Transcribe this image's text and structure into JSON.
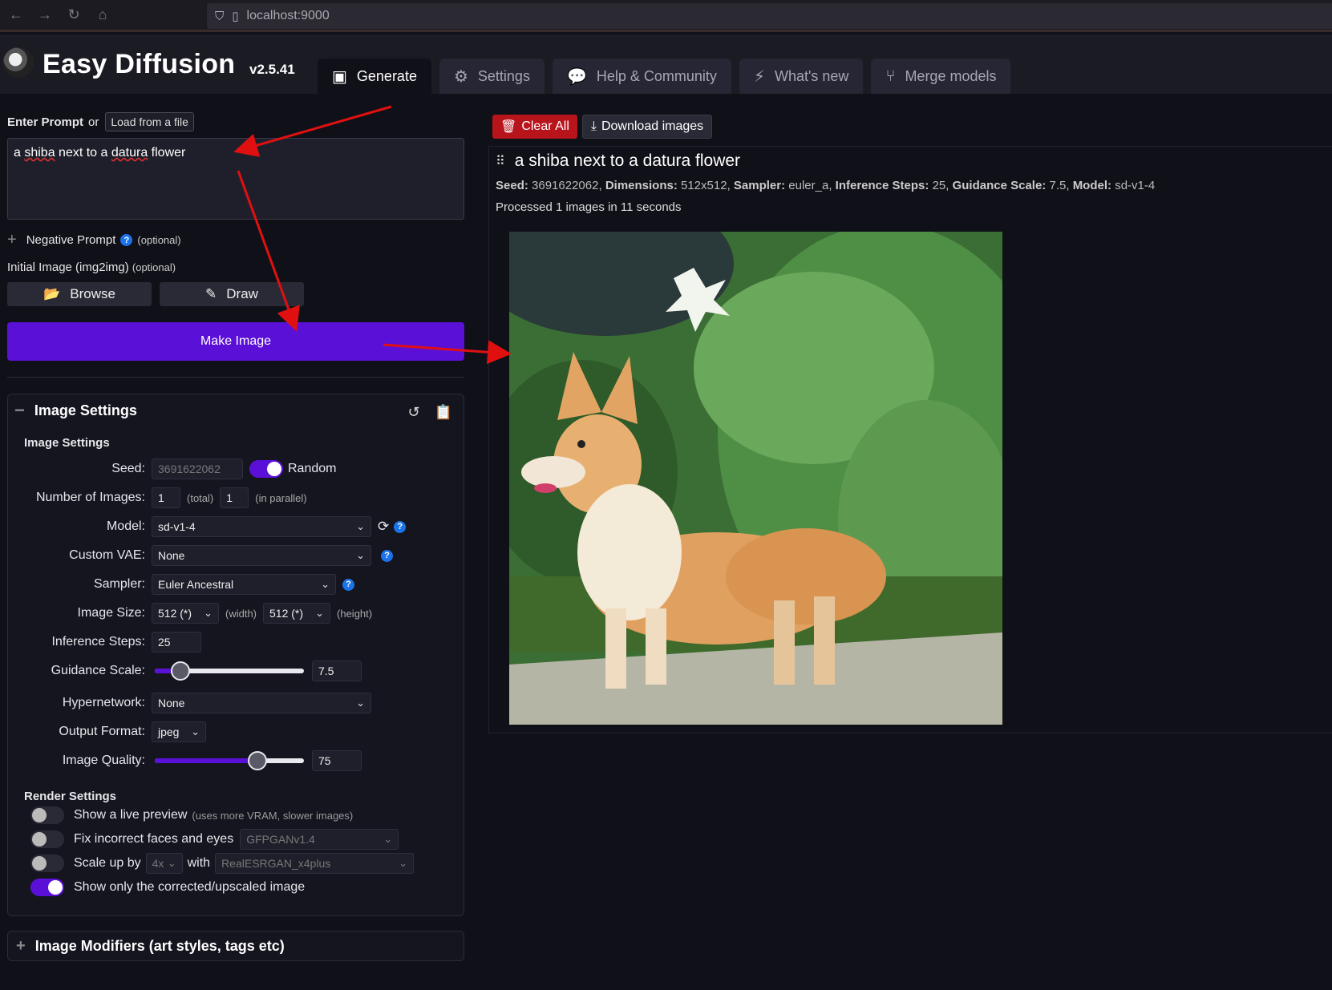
{
  "browser": {
    "url": "localhost:9000"
  },
  "app": {
    "title": "Easy Diffusion",
    "version": "v2.5.41"
  },
  "tabs": [
    {
      "label": "Generate",
      "icon": "image-icon",
      "active": true
    },
    {
      "label": "Settings",
      "icon": "gear-icon"
    },
    {
      "label": "Help & Community",
      "icon": "comments-icon"
    },
    {
      "label": "What's new",
      "icon": "bolt-icon"
    },
    {
      "label": "Merge models",
      "icon": "merge-icon"
    }
  ],
  "prompt": {
    "label": "Enter Prompt",
    "or": "or",
    "load_button": "Load from a file",
    "text_parts": [
      "a ",
      "shiba",
      " next to a ",
      "datura",
      " flower"
    ]
  },
  "negative": {
    "label": "Negative Prompt",
    "optional": "(optional)"
  },
  "initial_image": {
    "label": "Initial Image (img2img)",
    "optional": "(optional)"
  },
  "buttons": {
    "browse": "Browse",
    "draw": "Draw",
    "make_image": "Make Image"
  },
  "image_settings": {
    "panel_title": "Image Settings",
    "section_title": "Image Settings",
    "seed": {
      "label": "Seed:",
      "value": "3691622062",
      "random_label": "Random",
      "random_on": true
    },
    "num_images": {
      "label": "Number of Images:",
      "total": "1",
      "total_note": "(total)",
      "parallel": "1",
      "parallel_note": "(in parallel)"
    },
    "model": {
      "label": "Model:",
      "value": "sd-v1-4"
    },
    "vae": {
      "label": "Custom VAE:",
      "value": "None"
    },
    "sampler": {
      "label": "Sampler:",
      "value": "Euler Ancestral"
    },
    "size": {
      "label": "Image Size:",
      "width": "512 (*)",
      "width_note": "(width)",
      "height": "512 (*)",
      "height_note": "(height)"
    },
    "steps": {
      "label": "Inference Steps:",
      "value": "25"
    },
    "guidance": {
      "label": "Guidance Scale:",
      "value": "7.5",
      "fraction": 0.17
    },
    "hypernetwork": {
      "label": "Hypernetwork:",
      "value": "None"
    },
    "output_format": {
      "label": "Output Format:",
      "value": "jpeg"
    },
    "quality": {
      "label": "Image Quality:",
      "value": "75",
      "fraction": 0.69
    }
  },
  "render_settings": {
    "title": "Render Settings",
    "live_preview": {
      "label": "Show a live preview",
      "note": "(uses more VRAM, slower images)",
      "on": false
    },
    "fix_faces": {
      "label": "Fix incorrect faces and eyes",
      "model": "GFPGANv1.4",
      "on": false
    },
    "upscale": {
      "label": "Scale up by",
      "factor": "4x",
      "with": "with",
      "model": "RealESRGAN_x4plus",
      "on": false
    },
    "show_only": {
      "label": "Show only the corrected/upscaled image",
      "on": true
    }
  },
  "modifiers": {
    "title": "Image Modifiers (art styles, tags etc)"
  },
  "result": {
    "clear_all": "Clear All",
    "download": "Download images",
    "title": "a shiba next to a datura flower",
    "meta": {
      "seed_label": "Seed:",
      "seed": "3691622062",
      "dims_label": "Dimensions:",
      "dims": "512x512",
      "sampler_label": "Sampler:",
      "sampler": "euler_a",
      "steps_label": "Inference Steps:",
      "steps": "25",
      "guidance_label": "Guidance Scale:",
      "guidance": "7.5",
      "model_label": "Model:",
      "model": "sd-v1-4"
    },
    "processed": "Processed 1 images in 11 seconds"
  },
  "colors": {
    "accent": "#5b10d8",
    "danger": "#b8141c",
    "annotation_arrow": "#e01010"
  }
}
